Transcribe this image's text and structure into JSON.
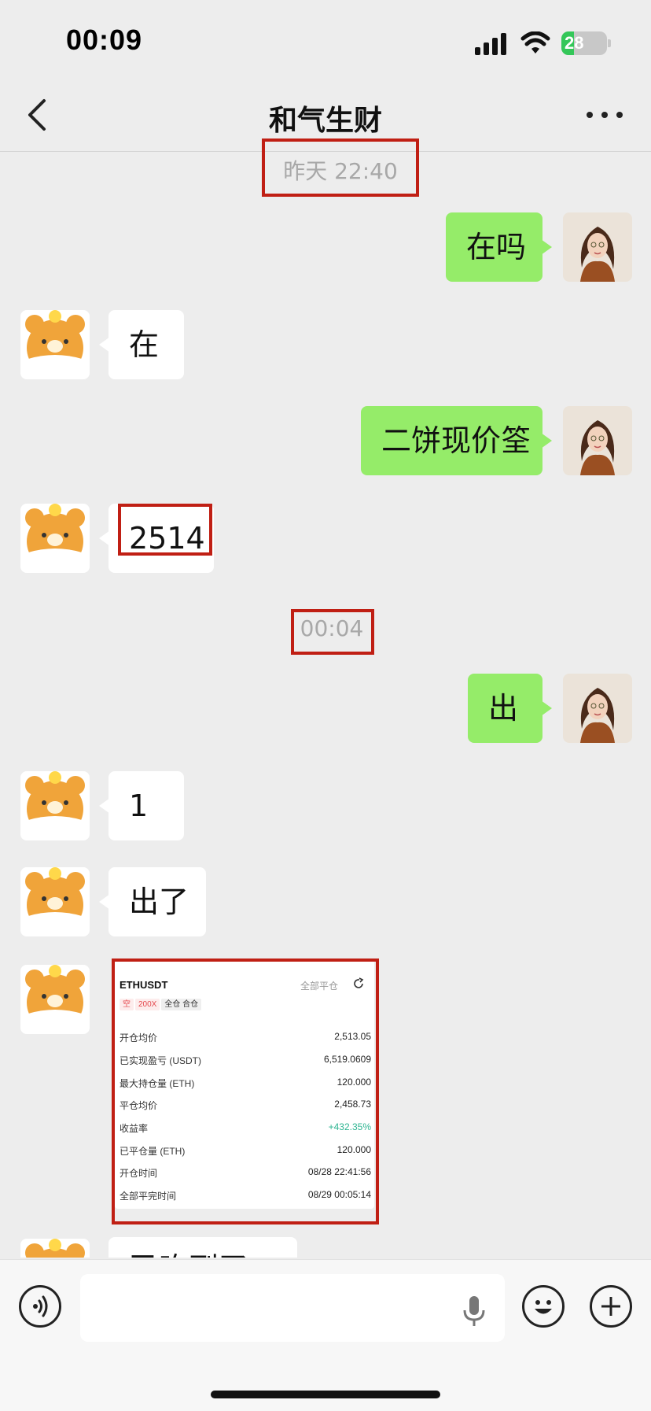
{
  "status_bar": {
    "time": "00:09",
    "battery": "28",
    "battery_level": 0.28
  },
  "nav": {
    "title": "和气生财"
  },
  "messages": {
    "ts1": "昨天 22:40",
    "m1": "在吗",
    "m2": "在",
    "m3": "二饼现价筌",
    "m4": "2514",
    "ts2": "00:04",
    "m5": "出",
    "m6": "1",
    "m7": "出了",
    "m8_partial": "已吃到了"
  },
  "trade_card": {
    "symbol": "ETHUSDT",
    "status": "全部平仓",
    "tags": [
      "空",
      "200X",
      "全仓 合仓"
    ],
    "rows": [
      {
        "label": "开仓均价",
        "value": "2,513.05"
      },
      {
        "label": "已实现盈亏 (USDT)",
        "value": "6,519.0609"
      },
      {
        "label": "最大持仓量 (ETH)",
        "value": "120.000"
      },
      {
        "label": "平仓均价",
        "value": "2,458.73"
      },
      {
        "label": "收益率",
        "value": "+432.35%"
      },
      {
        "label": "已平仓量 (ETH)",
        "value": "120.000"
      },
      {
        "label": "开仓时间",
        "value": "08/28 22:41:56"
      },
      {
        "label": "全部平完时间",
        "value": "08/29 00:05:14"
      }
    ]
  },
  "colors": {
    "my_bubble": "#95ec69",
    "their_bubble": "#ffffff",
    "highlight_box": "#c01f14",
    "profit_green": "#2fb592",
    "short_tag_red": "#e5484d"
  },
  "icons": [
    "back-arrow-icon",
    "more-icon",
    "signal-icon",
    "wifi-icon",
    "battery-icon",
    "voice-icon",
    "mic-icon",
    "emoji-icon",
    "plus-icon",
    "share-icon"
  ]
}
